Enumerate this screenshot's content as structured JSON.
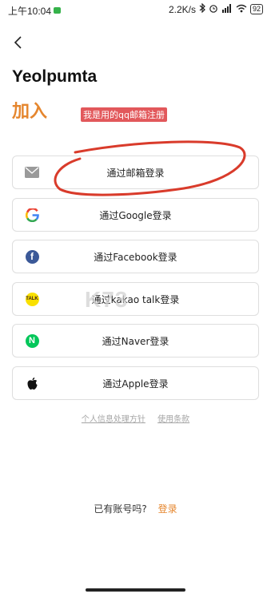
{
  "status_bar": {
    "time": "上午10:04",
    "speed": "2.2K/s",
    "battery": "92"
  },
  "app": {
    "name": "Yeolpumta",
    "join_label": "加入"
  },
  "annotation": {
    "tag": "我是用的qq邮箱注册"
  },
  "buttons": [
    {
      "label": "通过邮箱登录",
      "icon": "mail-icon"
    },
    {
      "label": "通过Google登录",
      "icon": "google-icon"
    },
    {
      "label": "通过Facebook登录",
      "icon": "facebook-icon"
    },
    {
      "label": "通过kakao talk登录",
      "icon": "kakaotalk-icon"
    },
    {
      "label": "通过Naver登录",
      "icon": "naver-icon"
    },
    {
      "label": "通过Apple登录",
      "icon": "apple-icon"
    }
  ],
  "links": {
    "privacy": "个人信息处理方针",
    "terms": "使用条款"
  },
  "account": {
    "question": "已有账号吗?",
    "login": "登录"
  },
  "watermark": {
    "text": "K73"
  },
  "colors": {
    "accent": "#e5862e",
    "annotation": "#d93b2b",
    "facebook": "#3b5998",
    "kakao": "#f9e000",
    "naver": "#03c75a"
  }
}
